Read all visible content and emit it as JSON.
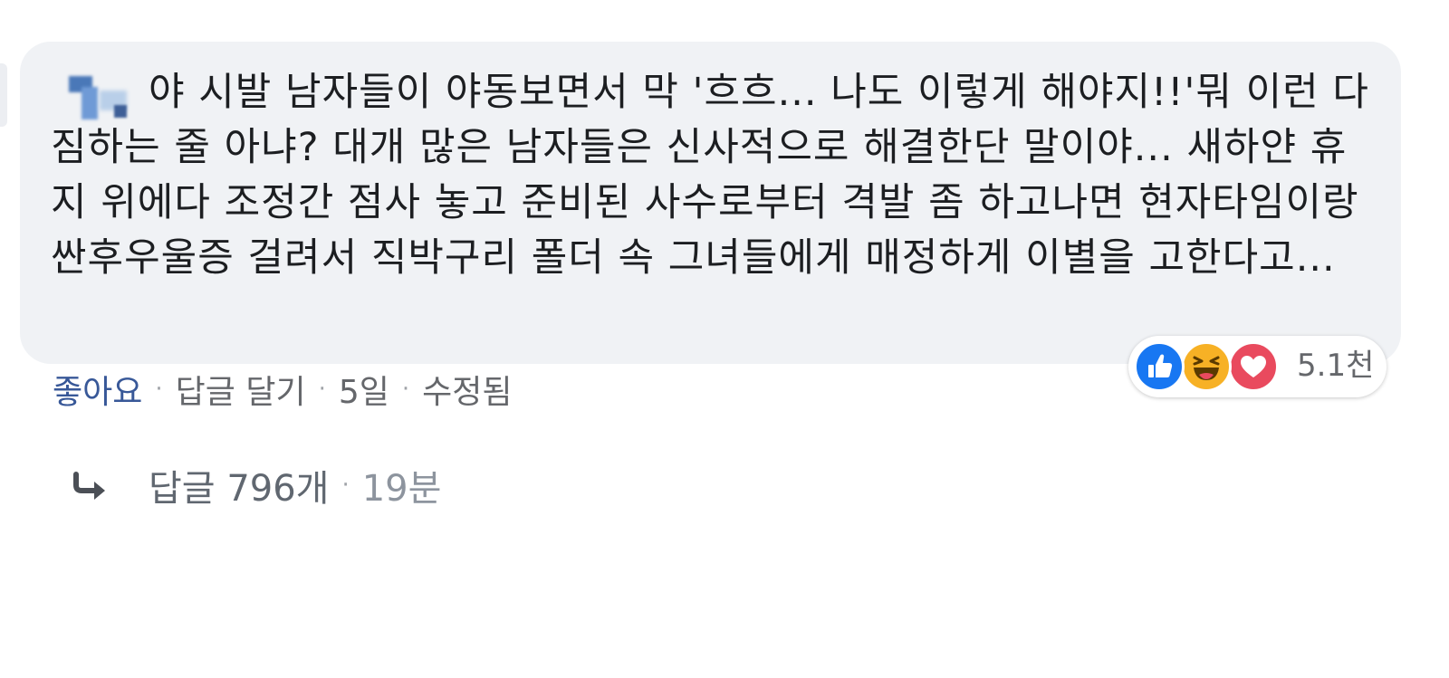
{
  "comment": {
    "text": "야 시발 남자들이 야동보면서 막 '흐흐... 나도 이렇게 해야지!!'뭐 이런 다짐하는 줄 아냐? 대개 많은 남자들은 신사적으로 해결한단 말이야... 새하얀 휴지 위에다 조정간 점사 놓고 준비된 사수로부터 격발 좀 하고나면 현자타임이랑 싼후우울증 걸려서 직박구리 폴더 속 그녀들에게 매정하게 이별을 고한다고..."
  },
  "actions": {
    "like": "좋아요",
    "reply": "답글 달기",
    "time": "5일",
    "edited": "수정됨",
    "separator": "·"
  },
  "reactions": {
    "icons": [
      "like-icon",
      "haha-icon",
      "love-icon"
    ],
    "count": "5.1천",
    "colors": {
      "like": "#1877f2",
      "haha": "#f7b125",
      "love": "#e94a5e"
    }
  },
  "replies": {
    "label": "답글 796개",
    "separator": "·",
    "time": "19분"
  },
  "colors": {
    "bubble": "#f0f2f5",
    "text": "#1c1e21",
    "meta": "#65676b",
    "link": "#385898"
  }
}
